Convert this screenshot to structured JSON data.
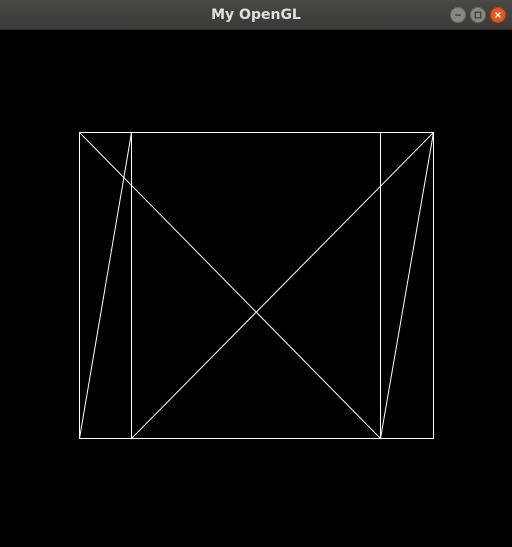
{
  "window": {
    "title": "My OpenGL",
    "controls": {
      "minimize_icon": "minimize-icon",
      "maximize_icon": "maximize-icon",
      "close_icon": "close-icon",
      "close_color": "#e9541f",
      "button_color": "#8a8882"
    }
  },
  "scene": {
    "background_color": "#000000",
    "line_color": "#ffffff",
    "render_mode": "wireframe"
  }
}
